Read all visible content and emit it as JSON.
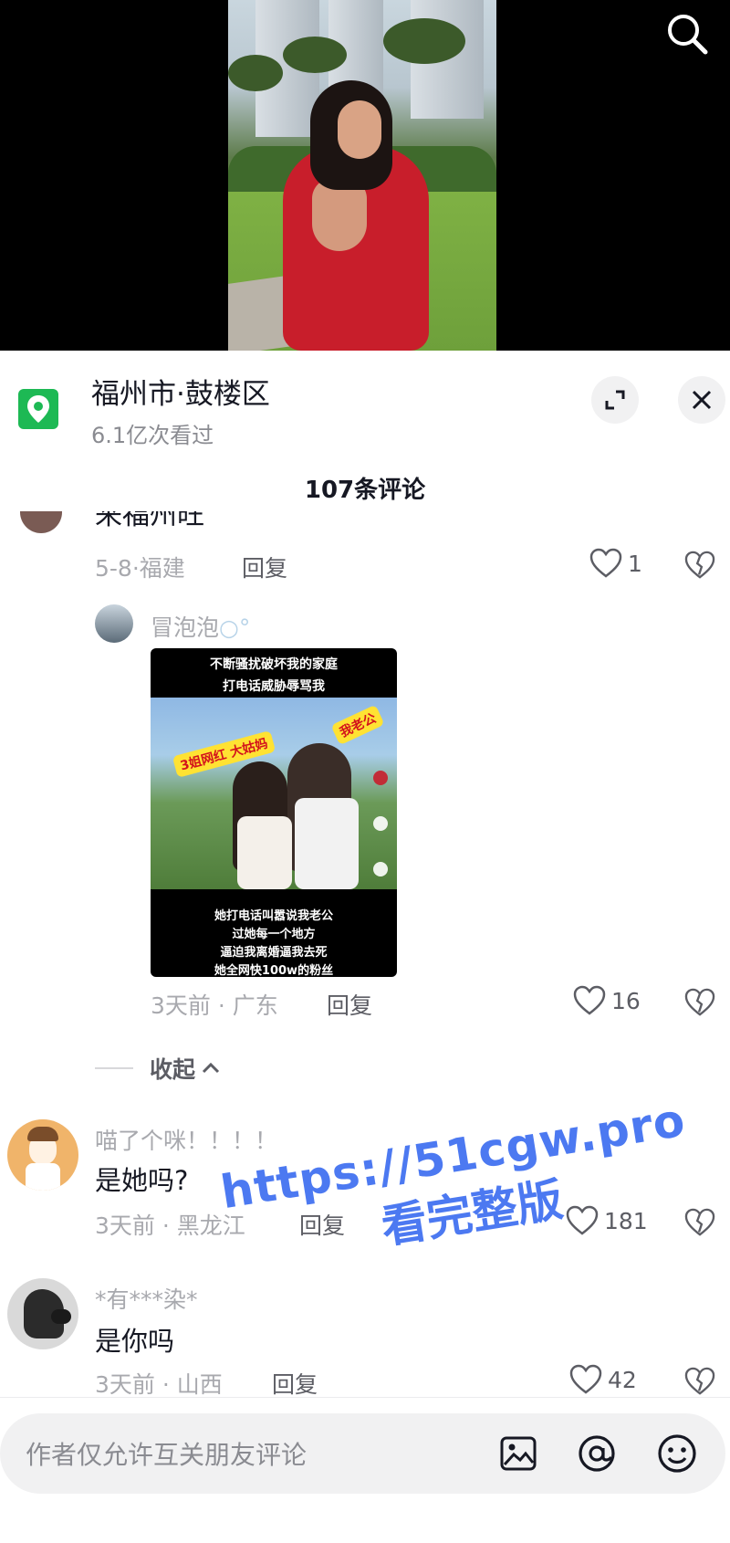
{
  "location": {
    "title": "福州市·鼓楼区",
    "views": "6.1亿次看过"
  },
  "comments_header": "107条评论",
  "replies": [
    {
      "truncated_text": "来福州旺",
      "date": "5-8",
      "region": "福建",
      "reply_label": "回复",
      "likes": "1"
    },
    {
      "name": "冒泡泡",
      "image": {
        "top_caption_line1": "不断骚扰破坏我的家庭",
        "top_caption_line2": "打电话威胁辱骂我",
        "sticker_left": "3姐网红 大姑妈",
        "sticker_right": "我老公",
        "bottom_line1": "她打电话叫嚣说我老公",
        "bottom_line2": "过她每一个地方",
        "bottom_line3": "逼迫我离婚逼我去死",
        "bottom_line4": "她全网快100w的粉丝"
      },
      "date": "3天前",
      "region": "广东",
      "reply_label": "回复",
      "likes": "16"
    }
  ],
  "collapse_label": "收起",
  "comments": [
    {
      "name": "喵了个咪！！！！",
      "text": "是她吗?",
      "date": "3天前",
      "region": "黑龙江",
      "reply_label": "回复",
      "likes": "181"
    },
    {
      "name": "*有***染*",
      "text": "是你吗",
      "date": "3天前",
      "region": "山西",
      "reply_label": "回复",
      "likes": "42"
    }
  ],
  "watermark": {
    "line1": "https://51cgw.pro",
    "line2": "看完整版"
  },
  "input": {
    "placeholder": "作者仅允许互关朋友评论"
  },
  "icons": {
    "search": "search-icon",
    "location": "location-pin-icon",
    "expand": "expand-icon",
    "close": "close-icon",
    "like": "heart-icon",
    "dislike": "broken-heart-icon",
    "image": "image-icon",
    "mention": "at-icon",
    "emoji": "emoji-icon"
  },
  "colors": {
    "location_badge": "#1db954",
    "watermark": "#3f6ff0",
    "meta_text": "#a8a9ae"
  }
}
